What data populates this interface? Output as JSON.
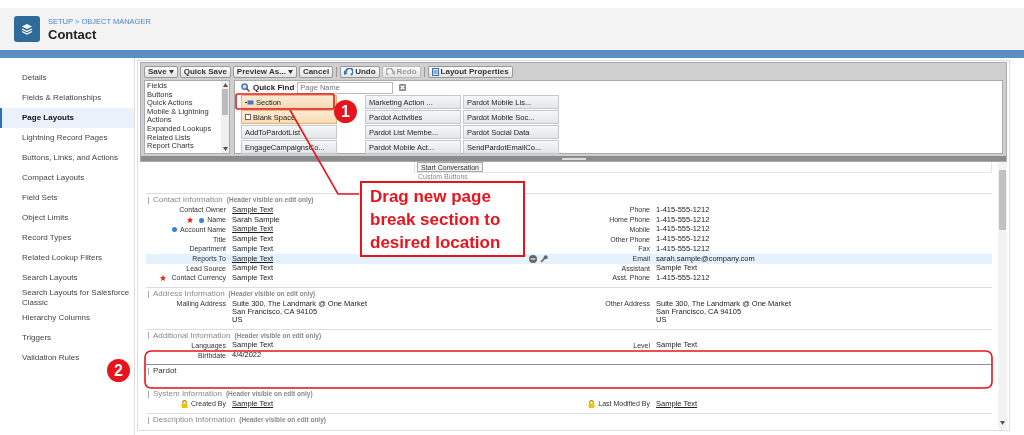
{
  "header": {
    "breadcrumb": "SETUP > OBJECT MANAGER",
    "title": "Contact"
  },
  "sidebar": {
    "items": [
      {
        "label": "Details",
        "selected": false
      },
      {
        "label": "Fields & Relationships",
        "selected": false
      },
      {
        "label": "Page Layouts",
        "selected": true
      },
      {
        "label": "Lightning Record Pages",
        "selected": false
      },
      {
        "label": "Buttons, Links, and Actions",
        "selected": false
      },
      {
        "label": "Compact Layouts",
        "selected": false
      },
      {
        "label": "Field Sets",
        "selected": false
      },
      {
        "label": "Object Limits",
        "selected": false
      },
      {
        "label": "Record Types",
        "selected": false
      },
      {
        "label": "Related Lookup Filters",
        "selected": false
      },
      {
        "label": "Search Layouts",
        "selected": false
      },
      {
        "label": "Search Layouts for Salesforce Classic",
        "selected": false
      },
      {
        "label": "Hierarchy Columns",
        "selected": false
      },
      {
        "label": "Triggers",
        "selected": false
      },
      {
        "label": "Validation Rules",
        "selected": false
      }
    ]
  },
  "toolbar": [
    {
      "label": "Save",
      "kind": "dropdown",
      "disabled": false
    },
    {
      "label": "Quick Save",
      "kind": "plain",
      "disabled": false
    },
    {
      "label": "Preview As...",
      "kind": "dropdown",
      "disabled": false
    },
    {
      "label": "Cancel",
      "kind": "plain",
      "disabled": false
    },
    {
      "label": "Undo",
      "kind": "undo",
      "disabled": false
    },
    {
      "label": "Redo",
      "kind": "redo",
      "disabled": true
    },
    {
      "label": "Layout Properties",
      "kind": "properties",
      "disabled": false
    }
  ],
  "palette": {
    "categories": [
      "Fields",
      "Buttons",
      "Quick Actions",
      "Mobile & Lightning Actions",
      "Expanded Lookups",
      "Related Lists",
      "Report Charts"
    ],
    "quick_find": {
      "label": "Quick Find",
      "placeholder": "Page Name"
    },
    "items": [
      {
        "label": "Section",
        "kind": "section"
      },
      {
        "label": "Marketing Action ...",
        "kind": "field"
      },
      {
        "label": "Pardot Mobile Lis...",
        "kind": "field"
      },
      {
        "label": "Blank Space",
        "kind": "blank-space"
      },
      {
        "label": "Pardot Activities",
        "kind": "field"
      },
      {
        "label": "Pardot Mobile Soc...",
        "kind": "field"
      },
      {
        "label": "AddToPardotList",
        "kind": "field"
      },
      {
        "label": "Pardot List Membe...",
        "kind": "field"
      },
      {
        "label": "Pardot Social Data",
        "kind": "field"
      },
      {
        "label": "EngageCampaignsCo...",
        "kind": "field"
      },
      {
        "label": "Pardot Mobile Act...",
        "kind": "field"
      },
      {
        "label": "SendPardotEmailCo...",
        "kind": "field"
      }
    ]
  },
  "canvas": {
    "start_conversation": "Start Conversation",
    "custom_buttons": "Custom Buttons",
    "sections": [
      {
        "title": "Contact Information",
        "note": "(Header visible on edit only)",
        "kind": "existing",
        "rows": [
          {
            "hovered": false,
            "left": {
              "label": "Contact Owner",
              "value": "Sample Text",
              "link": true
            },
            "right": {
              "label": "Phone",
              "value": "1-415-555-1212"
            }
          },
          {
            "hovered": false,
            "left": {
              "label": "Name",
              "value": "Sarah Sample",
              "required": true,
              "dot": true
            },
            "right": {
              "label": "Home Phone",
              "value": "1-415-555-1212"
            }
          },
          {
            "hovered": false,
            "left": {
              "label": "Account Name",
              "value": "Sample Text",
              "link": true,
              "dot": true
            },
            "right": {
              "label": "Mobile",
              "value": "1-415-555-1212"
            }
          },
          {
            "hovered": false,
            "left": {
              "label": "Title",
              "value": "Sample Text"
            },
            "right": {
              "label": "Other Phone",
              "value": "1-415-555-1212"
            }
          },
          {
            "hovered": false,
            "left": {
              "label": "Department",
              "value": "Sample Text"
            },
            "right": {
              "label": "Fax",
              "value": "1-415-555-1212"
            }
          },
          {
            "hovered": true,
            "left": {
              "label": "Reports To",
              "value": "Sample Text",
              "link": true
            },
            "right": {
              "label": "Email",
              "value": "sarah.sample@company.com"
            }
          },
          {
            "hovered": false,
            "left": {
              "label": "Lead Source",
              "value": "Sample Text"
            },
            "right": {
              "label": "Assistant",
              "value": "Sample Text"
            }
          },
          {
            "hovered": false,
            "left": {
              "label": "Contact Currency",
              "value": "Sample Text",
              "required": true
            },
            "right": {
              "label": "Asst. Phone",
              "value": "1-415-555-1212"
            }
          }
        ]
      },
      {
        "title": "Address Information",
        "note": "(Header visible on edit only)",
        "kind": "existing",
        "rows": [
          {
            "hovered": false,
            "left": {
              "label": "Mailing Address",
              "value": "Suite 300, The Landmark @ One Market\nSan Francisco, CA 94105\nUS"
            },
            "right": {
              "label": "Other Address",
              "value": "Suite 300, The Landmark @ One Market\nSan Francisco, CA 94105\nUS"
            }
          }
        ]
      },
      {
        "title": "Additional Information",
        "note": "(Header visible on edit only)",
        "kind": "existing",
        "rows": [
          {
            "hovered": false,
            "left": {
              "label": "Languages",
              "value": "Sample Text"
            },
            "right": {
              "label": "Level",
              "value": "Sample Text"
            }
          },
          {
            "hovered": false,
            "left": {
              "label": "Birthdate",
              "value": "4/4/2022"
            }
          }
        ]
      },
      {
        "title": "Pardot",
        "kind": "new"
      },
      {
        "title": "System Information",
        "note": "(Header visible on edit only)",
        "kind": "existing",
        "rows": [
          {
            "hovered": false,
            "left": {
              "label": "Created By",
              "value": "Sample Text",
              "link": true,
              "locked": true
            },
            "right": {
              "label": "Last Modified By",
              "value": "Sample Text",
              "link": true,
              "locked": true
            }
          }
        ]
      },
      {
        "title": "Description Information",
        "note": "(Header visible on edit only)",
        "kind": "existing"
      }
    ]
  },
  "callouts": [
    {
      "number": "1"
    },
    {
      "number": "2"
    }
  ],
  "instruction": "Drag new page break section to desired location"
}
